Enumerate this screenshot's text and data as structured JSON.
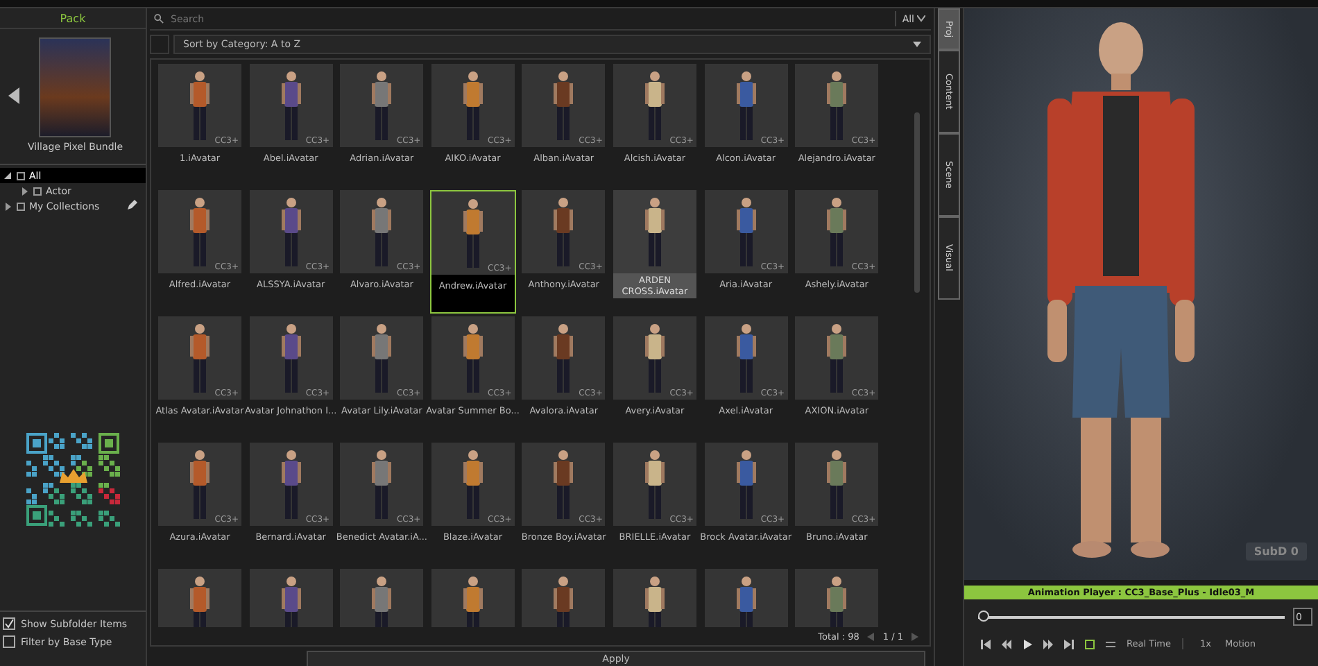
{
  "left_panel": {
    "header": "Pack",
    "pack": {
      "title": "Village Pixel Bundle"
    },
    "tree": [
      {
        "label": "All",
        "selected": true,
        "expanded": true,
        "children": [
          {
            "label": "Actor",
            "selected": false,
            "expanded": false
          }
        ]
      },
      {
        "label": "My Collections",
        "selected": false,
        "expanded": false
      }
    ],
    "options": [
      {
        "label": "Show Subfolder Items",
        "checked": true
      },
      {
        "label": "Filter by Base Type",
        "checked": false
      }
    ]
  },
  "library": {
    "search": {
      "placeholder": "Search"
    },
    "filter": "All",
    "sort": "Sort by Category: A to Z",
    "items": [
      {
        "label": "1.iAvatar",
        "badge": "CC3+",
        "selected": false,
        "hovered": false
      },
      {
        "label": "Abel.iAvatar",
        "badge": "CC3+",
        "selected": false,
        "hovered": false
      },
      {
        "label": "Adrian.iAvatar",
        "badge": "CC3+",
        "selected": false,
        "hovered": false
      },
      {
        "label": "AIKO.iAvatar",
        "badge": "CC3+",
        "selected": false,
        "hovered": false
      },
      {
        "label": "Alban.iAvatar",
        "badge": "CC3+",
        "selected": false,
        "hovered": false
      },
      {
        "label": "Alcish.iAvatar",
        "badge": "CC3+",
        "selected": false,
        "hovered": false
      },
      {
        "label": "Alcon.iAvatar",
        "badge": "CC3+",
        "selected": false,
        "hovered": false
      },
      {
        "label": "Alejandro.iAvatar",
        "badge": "CC3+",
        "selected": false,
        "hovered": false
      },
      {
        "label": "Alfred.iAvatar",
        "badge": "CC3+",
        "selected": false,
        "hovered": false
      },
      {
        "label": "ALSSYA.iAvatar",
        "badge": "CC3+",
        "selected": false,
        "hovered": false
      },
      {
        "label": "Alvaro.iAvatar",
        "badge": "CC3+",
        "selected": false,
        "hovered": false
      },
      {
        "label": "Andrew.iAvatar",
        "badge": "CC3+",
        "selected": true,
        "hovered": false
      },
      {
        "label": "Anthony.iAvatar",
        "badge": "CC3+",
        "selected": false,
        "hovered": false
      },
      {
        "label": "ARDEN CROSS.iAvatar",
        "selected": false,
        "hovered": true
      },
      {
        "label": "Aria.iAvatar",
        "badge": "CC3+",
        "selected": false,
        "hovered": false
      },
      {
        "label": "Ashely.iAvatar",
        "badge": "CC3+",
        "selected": false,
        "hovered": false
      },
      {
        "label": "Atlas Avatar.iAvatar",
        "badge": "CC3+",
        "selected": false,
        "hovered": false
      },
      {
        "label": "Avatar Johnathon I...",
        "badge": "CC3+",
        "selected": false,
        "hovered": false
      },
      {
        "label": "Avatar Lily.iAvatar",
        "badge": "CC3+",
        "selected": false,
        "hovered": false
      },
      {
        "label": "Avatar Summer Bo...",
        "badge": "CC3+",
        "selected": false,
        "hovered": false
      },
      {
        "label": "Avalora.iAvatar",
        "badge": "CC3+",
        "selected": false,
        "hovered": false
      },
      {
        "label": "Avery.iAvatar",
        "badge": "CC3+",
        "selected": false,
        "hovered": false
      },
      {
        "label": "Axel.iAvatar",
        "badge": "CC3+",
        "selected": false,
        "hovered": false
      },
      {
        "label": "AXION.iAvatar",
        "badge": "CC3+",
        "selected": false,
        "hovered": false
      },
      {
        "label": "Azura.iAvatar",
        "badge": "CC3+",
        "selected": false,
        "hovered": false
      },
      {
        "label": "Bernard.iAvatar",
        "badge": "CC3+",
        "selected": false,
        "hovered": false
      },
      {
        "label": "Benedict Avatar.iA...",
        "badge": "CC3+",
        "selected": false,
        "hovered": false
      },
      {
        "label": "Blaze.iAvatar",
        "badge": "CC3+",
        "selected": false,
        "hovered": false
      },
      {
        "label": "Bronze Boy.iAvatar",
        "badge": "CC3+",
        "selected": false,
        "hovered": false
      },
      {
        "label": "BRIELLE.iAvatar",
        "badge": "CC3+",
        "selected": false,
        "hovered": false
      },
      {
        "label": "Brock Avatar.iAvatar",
        "badge": "CC3+",
        "selected": false,
        "hovered": false
      },
      {
        "label": "Bruno.iAvatar",
        "badge": "CC3+",
        "selected": false,
        "hovered": false
      },
      {
        "selected": false
      },
      {
        "selected": false
      },
      {
        "selected": false
      },
      {
        "selected": false
      },
      {
        "selected": false
      },
      {
        "selected": false
      },
      {
        "selected": false
      },
      {
        "selected": false
      }
    ],
    "total": "Total : 98",
    "pagination": "1 / 1",
    "apply": "Apply"
  },
  "side_tabs": [
    {
      "label": "Proj",
      "selected": true
    },
    {
      "label": "Content",
      "selected": false
    },
    {
      "label": "Scene",
      "selected": false
    },
    {
      "label": "Visual",
      "selected": false
    }
  ],
  "viewport": {
    "badge": "SubD 0"
  },
  "animation_player": {
    "title": "Animation Player : CC3_Base_Plus - Idle03_M",
    "level": 0.0,
    "frame": "0",
    "mode": "Real Time",
    "speed": "1x",
    "motion": "Motion"
  }
}
